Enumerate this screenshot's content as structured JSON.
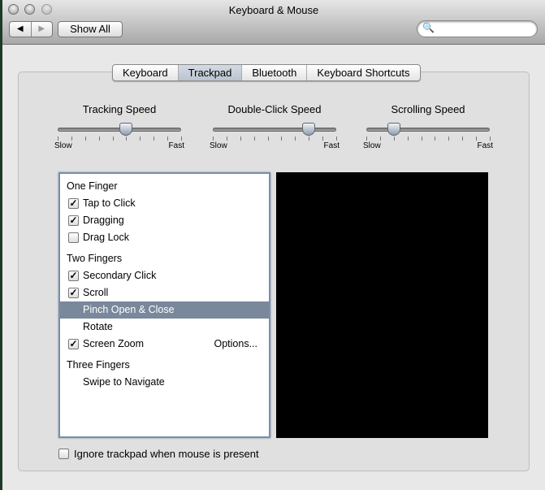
{
  "window": {
    "title": "Keyboard & Mouse"
  },
  "toolbar": {
    "back": "◀",
    "forward": "▶",
    "show_all": "Show All",
    "search_icon": "🔍",
    "search_placeholder": ""
  },
  "tabs": [
    {
      "label": "Keyboard"
    },
    {
      "label": "Trackpad",
      "selected": true
    },
    {
      "label": "Bluetooth"
    },
    {
      "label": "Keyboard Shortcuts"
    }
  ],
  "sliders": [
    {
      "label": "Tracking Speed",
      "min_label": "Slow",
      "max_label": "Fast",
      "value": 0.55
    },
    {
      "label": "Double-Click Speed",
      "min_label": "Slow",
      "max_label": "Fast",
      "value": 0.78
    },
    {
      "label": "Scrolling Speed",
      "min_label": "Slow",
      "max_label": "Fast",
      "value": 0.22
    }
  ],
  "gestures": {
    "one_finger": "One Finger",
    "tap_to_click": "Tap to Click",
    "dragging": "Dragging",
    "drag_lock": "Drag Lock",
    "two_fingers": "Two Fingers",
    "secondary_click": "Secondary Click",
    "scroll": "Scroll",
    "pinch": "Pinch Open & Close",
    "rotate": "Rotate",
    "screen_zoom": "Screen Zoom",
    "options": "Options...",
    "three_fingers": "Three Fingers",
    "swipe": "Swipe to Navigate",
    "check": "✓"
  },
  "ignore_trackpad": "Ignore trackpad when mouse is present"
}
